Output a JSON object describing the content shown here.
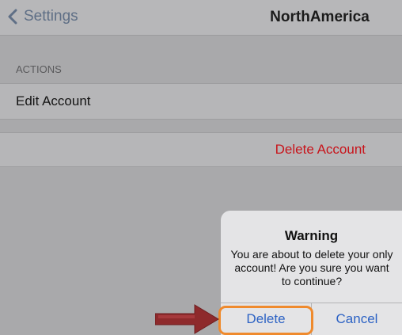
{
  "navbar": {
    "back_label": "Settings",
    "title": "NorthAmerica"
  },
  "section": {
    "header": "ACTIONS"
  },
  "rows": {
    "edit_account": "Edit Account",
    "delete_account": "Delete Account"
  },
  "alert": {
    "title": "Warning",
    "message": "You are about to delete your only account! Are you sure you want to continue?",
    "delete_label": "Delete",
    "cancel_label": "Cancel"
  },
  "colors": {
    "destructive": "#c8141b",
    "alert_button": "#2c62c4",
    "highlight": "#ef8a2d",
    "arrow": "#8e2a2c"
  },
  "icons": {
    "back": "chevron-left-icon",
    "pointer": "arrow-right-icon"
  }
}
